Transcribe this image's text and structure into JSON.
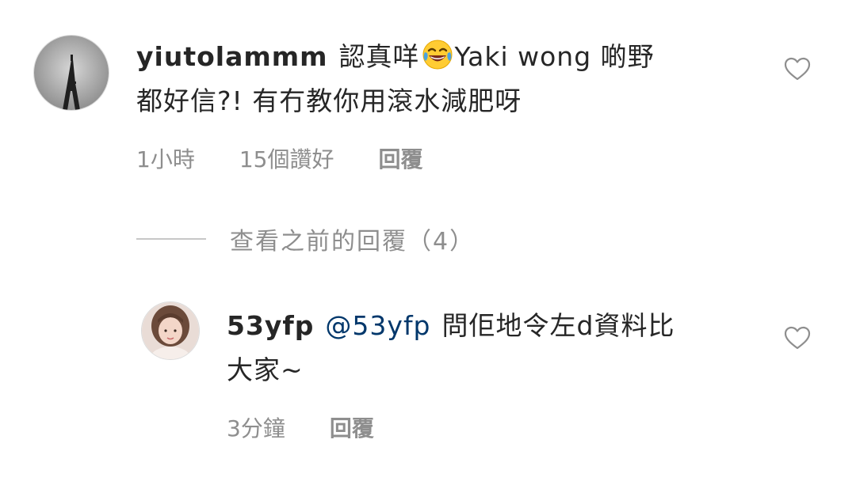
{
  "comments": [
    {
      "username": "yiutolammm",
      "text_before_emoji": "認真咩",
      "emoji": "joy-emoji",
      "text_after_emoji": "Yaki wong 啲野",
      "text_line2": "都好信?! 有冇教你用滾水減肥呀",
      "time": "1小時",
      "likes": "15個讚好",
      "reply": "回覆"
    },
    {
      "username": "53yfp",
      "mention": "@53yfp",
      "text_line1": "問佢地令左d資料比",
      "text_line2": "大家~",
      "time": "3分鐘",
      "reply": "回覆"
    }
  ],
  "view_replies": {
    "label": "查看之前的回覆（4）"
  },
  "colors": {
    "text": "#262626",
    "secondary": "#8e8e8e",
    "mention": "#00376b",
    "heart_outline": "#8e8e8e"
  }
}
